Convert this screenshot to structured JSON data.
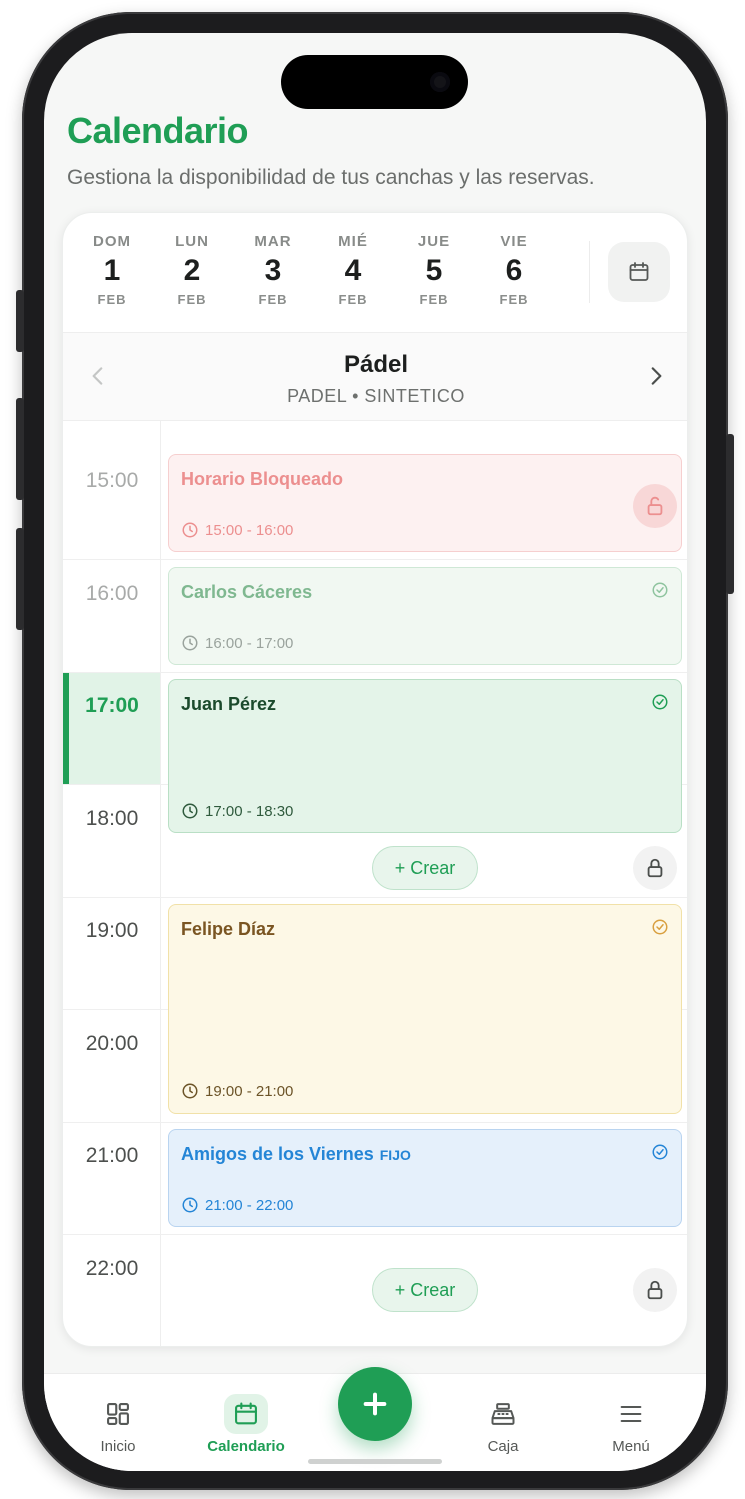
{
  "header": {
    "title": "Calendario",
    "subtitle": "Gestiona la disponibilidad de tus canchas y las reservas."
  },
  "days": [
    {
      "name": "DOM",
      "num": "1",
      "month": "FEB"
    },
    {
      "name": "LUN",
      "num": "2",
      "month": "FEB"
    },
    {
      "name": "MAR",
      "num": "3",
      "month": "FEB"
    },
    {
      "name": "MIÉ",
      "num": "4",
      "month": "FEB"
    },
    {
      "name": "JUE",
      "num": "5",
      "month": "FEB"
    },
    {
      "name": "VIE",
      "num": "6",
      "month": "FEB"
    }
  ],
  "court": {
    "name": "Pádel",
    "type": "PADEL • SINTETICO"
  },
  "hours": [
    "15:00",
    "16:00",
    "17:00",
    "18:00",
    "19:00",
    "20:00",
    "21:00",
    "22:00"
  ],
  "events": {
    "blocked": {
      "title": "Horario Bloqueado",
      "time": "15:00 - 16:00"
    },
    "past": {
      "title": "Carlos Cáceres",
      "time": "16:00 - 17:00"
    },
    "current": {
      "title": "Juan Pérez",
      "time": "17:00 - 18:30"
    },
    "pending": {
      "title": "Felipe Díaz",
      "time": "19:00 - 21:00"
    },
    "fixed": {
      "title": "Amigos de los Viernes",
      "tag": "FIJO",
      "time": "21:00 - 22:00"
    }
  },
  "create_label": "+ Crear",
  "nav": {
    "inicio": "Inicio",
    "calendario": "Calendario",
    "caja": "Caja",
    "menu": "Menú"
  },
  "colors": {
    "brand": "#1f9e55",
    "blocked": "#ec8f8f",
    "pending": "#d9a040",
    "fixed": "#2485d6"
  }
}
